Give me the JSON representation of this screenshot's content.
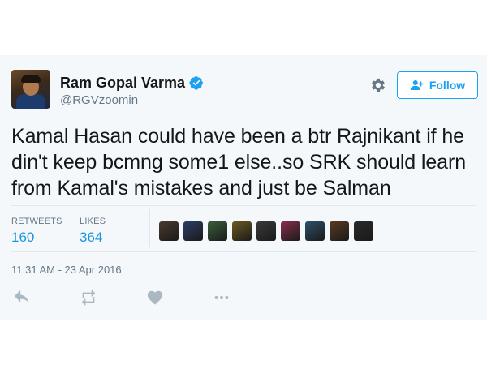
{
  "tweet": {
    "author_name": "Ram Gopal Varma",
    "handle": "@RGVzoomin",
    "text": "Kamal Hasan could have been a btr Rajnikant if he din't keep bcmng some1 else..so SRK should learn from Kamal's mistakes and just be Salman",
    "timestamp": "11:31 AM - 23 Apr 2016"
  },
  "header": {
    "follow_label": "Follow"
  },
  "stats": {
    "retweets_label": "RETWEETS",
    "retweets_count": "160",
    "likes_label": "LIKES",
    "likes_count": "364"
  },
  "likers": [
    {
      "icon": "liker-avatar",
      "color": "#4a3a2e"
    },
    {
      "icon": "liker-avatar",
      "color": "#2c3e66"
    },
    {
      "icon": "liker-avatar",
      "color": "#3b5e3a"
    },
    {
      "icon": "liker-avatar",
      "color": "#6e5a20"
    },
    {
      "icon": "liker-avatar",
      "color": "#3a3a3a"
    },
    {
      "icon": "liker-avatar",
      "color": "#8a2e4c"
    },
    {
      "icon": "liker-avatar",
      "color": "#2f4f6a"
    },
    {
      "icon": "liker-avatar",
      "color": "#5a3a22"
    },
    {
      "icon": "liker-avatar",
      "color": "#2a2a2a"
    }
  ],
  "colors": {
    "accent": "#1da1f2",
    "count": "#1b95e0",
    "muted": "#657786",
    "text": "#14171a",
    "card_background": "#f5f8fa"
  },
  "icons": {
    "verified": "verified-badge-icon",
    "settings": "gear-icon",
    "follow": "add-user-icon",
    "reply": "reply-icon",
    "retweet": "retweet-icon",
    "like": "heart-icon",
    "more": "more-icon"
  }
}
